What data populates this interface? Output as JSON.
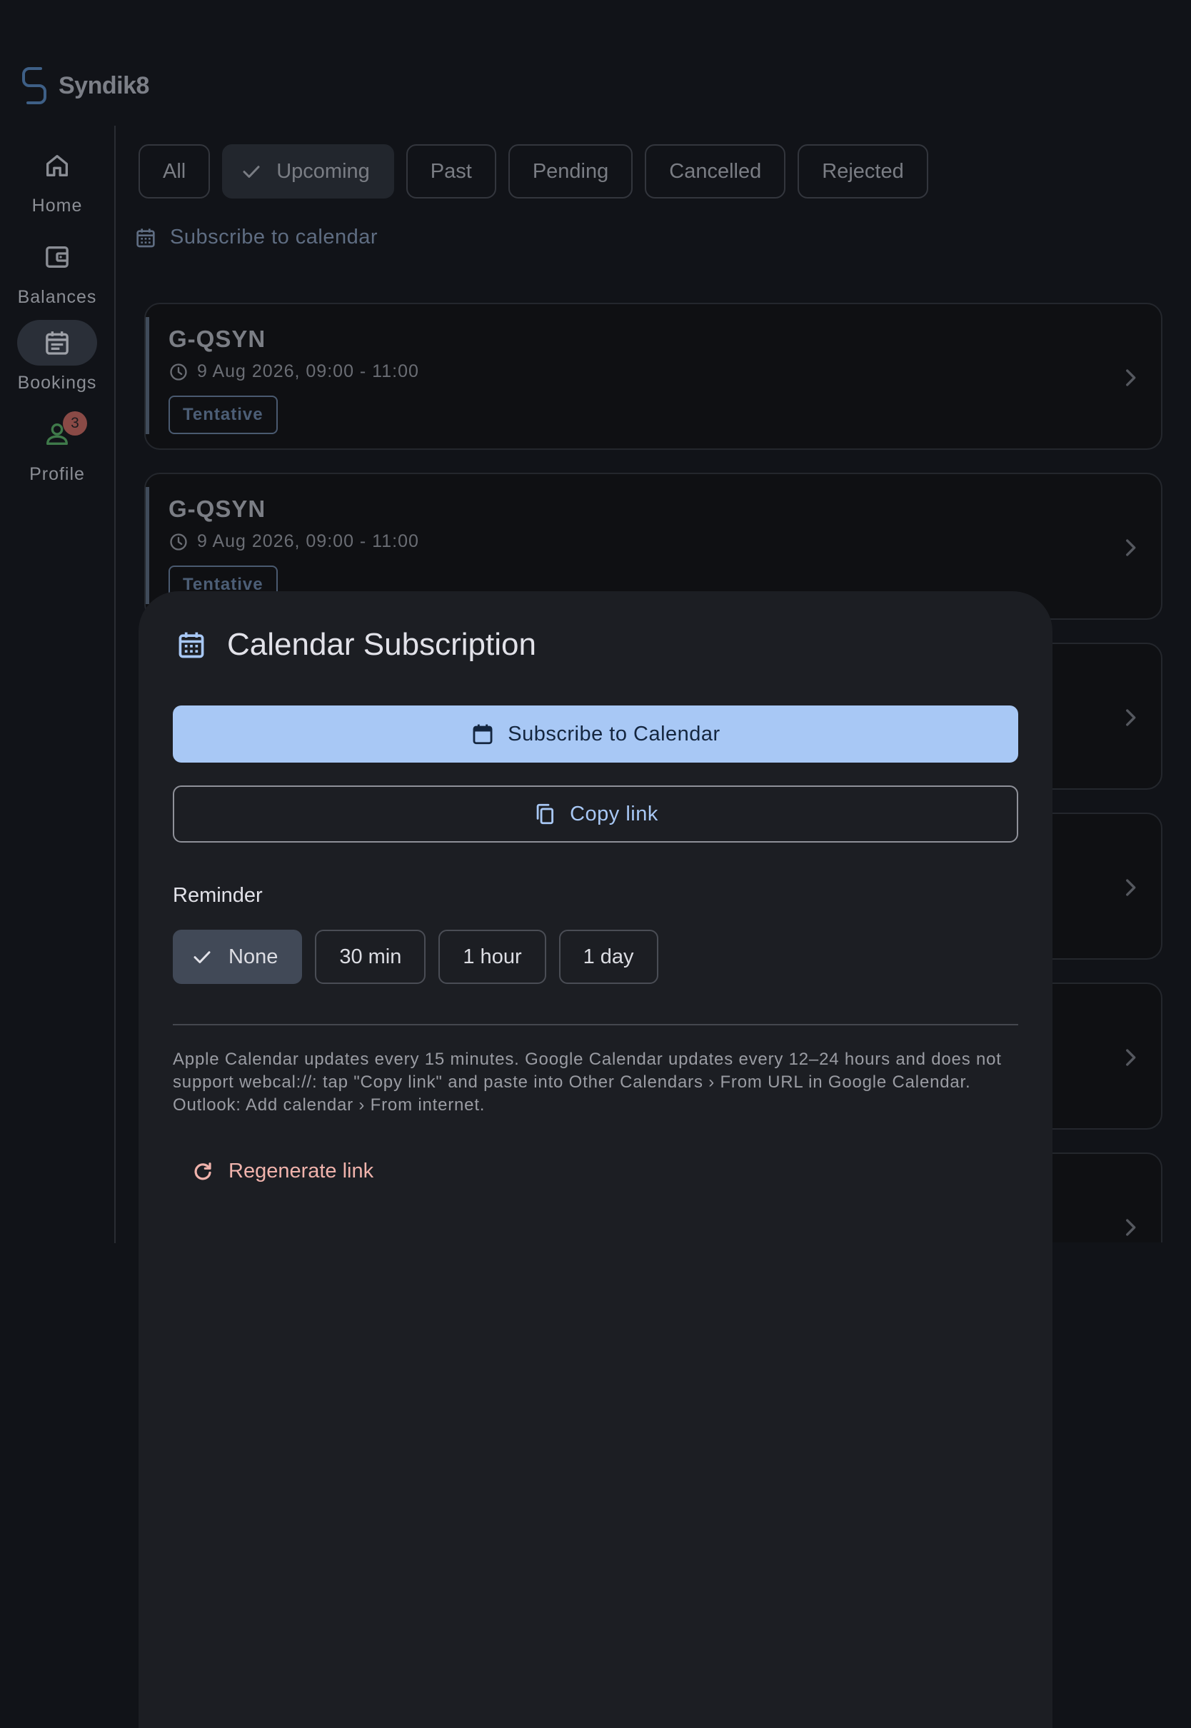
{
  "app": {
    "name": "Syndik8"
  },
  "nav": {
    "items": [
      {
        "label": "Home",
        "icon": "home-icon"
      },
      {
        "label": "Balances",
        "icon": "wallet-icon"
      },
      {
        "label": "Bookings",
        "icon": "calendar-icon",
        "active": true
      },
      {
        "label": "Profile",
        "icon": "person-icon",
        "badge": "3"
      }
    ]
  },
  "filters": {
    "chips": [
      "All",
      "Upcoming",
      "Past",
      "Pending",
      "Cancelled",
      "Rejected"
    ],
    "selected": "Upcoming"
  },
  "subscribe_link": "Subscribe to calendar",
  "bookings": [
    {
      "registration": "G-QSYN",
      "time": "9 Aug 2026, 09:00 - 11:00",
      "status": "Tentative"
    },
    {
      "registration": "G-QSYN",
      "time": "9 Aug 2026, 09:00 - 11:00",
      "status": "Tentative"
    }
  ],
  "sheet": {
    "title": "Calendar Subscription",
    "subscribe_button": "Subscribe to Calendar",
    "copy_button": "Copy link",
    "reminder_label": "Reminder",
    "reminder_options": [
      "None",
      "30 min",
      "1 hour",
      "1 day"
    ],
    "reminder_selected": "None",
    "note": "Apple Calendar updates every 15 minutes. Google Calendar updates every 12–24 hours and does not support webcal://: tap \"Copy link\" and paste into Other Calendars › From URL in Google Calendar. Outlook: Add calendar › From internet.",
    "regenerate": "Regenerate link"
  },
  "colors": {
    "background": "#111318",
    "primary": "#a8c8f5",
    "error_text": "#f0b3ac",
    "badge": "#8a4a46",
    "profile_icon": "#3f7a4a"
  }
}
